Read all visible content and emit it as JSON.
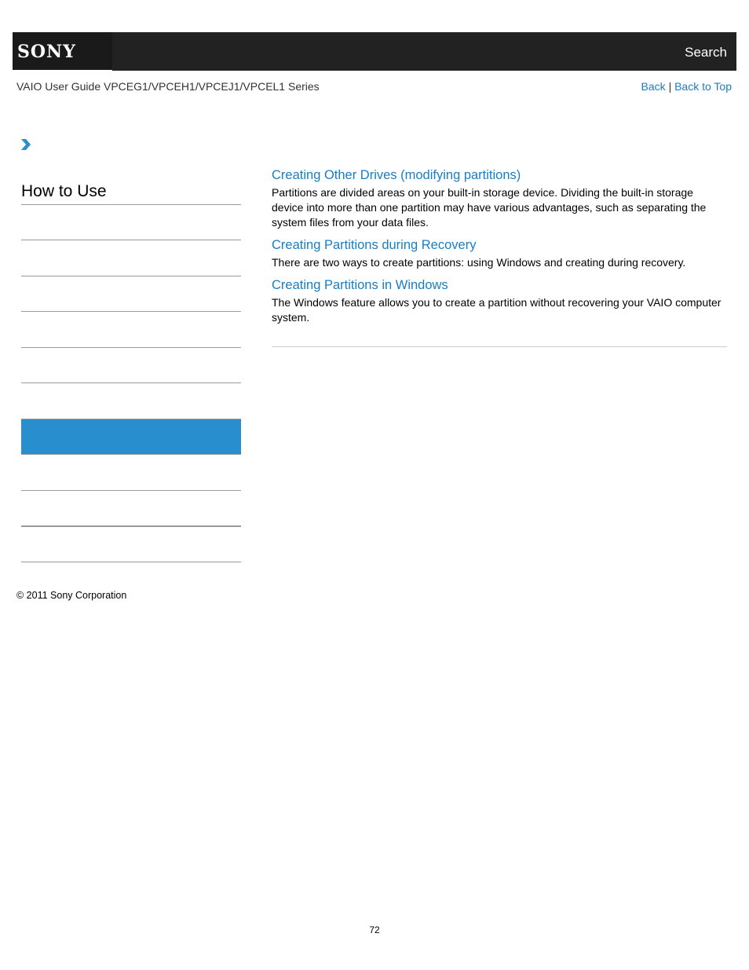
{
  "header": {
    "brand": "SONY",
    "search_label": "Search"
  },
  "subheader": {
    "guide_title": "VAIO User Guide VPCEG1/VPCEH1/VPCEJ1/VPCEL1 Series",
    "back_label": "Back",
    "separator": "|",
    "back_to_top_label": "Back to Top"
  },
  "sidebar": {
    "heading": "How to Use",
    "items": [
      {
        "label": "",
        "active": false
      },
      {
        "label": "",
        "active": false
      },
      {
        "label": "",
        "active": false
      },
      {
        "label": "",
        "active": false
      },
      {
        "label": "",
        "active": false
      },
      {
        "label": "",
        "active": true
      },
      {
        "label": "",
        "active": false
      },
      {
        "label": "",
        "active": false
      },
      {
        "label": "",
        "active": false
      }
    ]
  },
  "main": {
    "topics": [
      {
        "title": "Creating Other Drives (modifying partitions)",
        "description": "Partitions are divided areas on your built-in storage device. Dividing the built-in storage device into more than one partition may have various advantages, such as separating the system files from your data files."
      },
      {
        "title": "Creating Partitions during Recovery",
        "description": "There are two ways to create partitions: using Windows and creating during recovery."
      },
      {
        "title": "Creating Partitions in Windows",
        "description": "The Windows feature allows you to create a partition without recovering your VAIO computer system."
      }
    ]
  },
  "footer": {
    "copyright": "© 2011 Sony Corporation",
    "page_number": "72"
  },
  "colors": {
    "accent": "#1a7dc4",
    "active_item": "#288ecd",
    "header_bg": "#222222"
  }
}
